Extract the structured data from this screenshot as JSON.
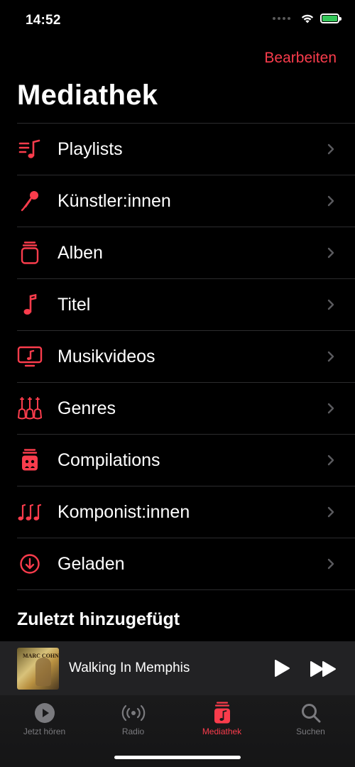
{
  "status_bar": {
    "time": "14:52"
  },
  "header": {
    "edit_label": "Bearbeiten",
    "title": "Mediathek"
  },
  "library_items": [
    {
      "label": "Playlists"
    },
    {
      "label": "Künstler:innen"
    },
    {
      "label": "Alben"
    },
    {
      "label": "Titel"
    },
    {
      "label": "Musikvideos"
    },
    {
      "label": "Genres"
    },
    {
      "label": "Compilations"
    },
    {
      "label": "Komponist:innen"
    },
    {
      "label": "Geladen"
    }
  ],
  "recently_added": {
    "title": "Zuletzt hinzugefügt"
  },
  "mini_player": {
    "track_title": "Walking In Memphis",
    "album_art_text": "MARC COHN"
  },
  "tab_bar": {
    "tabs": [
      {
        "label": "Jetzt hören",
        "active": false
      },
      {
        "label": "Radio",
        "active": false
      },
      {
        "label": "Mediathek",
        "active": true
      },
      {
        "label": "Suchen",
        "active": false
      }
    ]
  },
  "colors": {
    "accent": "#fa3c4c",
    "background": "#000000",
    "separator": "#2c2c2e",
    "battery": "#34c759"
  }
}
